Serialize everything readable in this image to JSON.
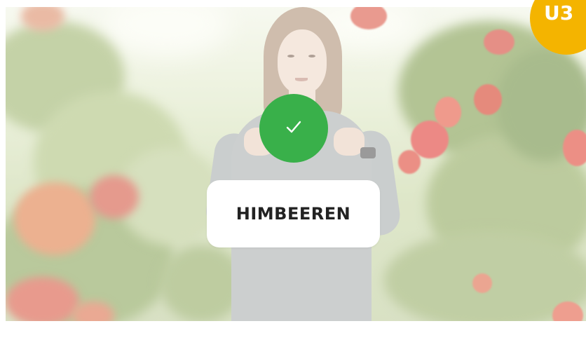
{
  "lesson": {
    "unit_badge": "U3",
    "answer_word": "HIMBEEREN",
    "feedback_icon": "check-icon",
    "feedback_state": "correct"
  },
  "colors": {
    "correct": "#39b04a",
    "badge": "#f4b400",
    "card": "#ffffff",
    "text": "#222222"
  }
}
